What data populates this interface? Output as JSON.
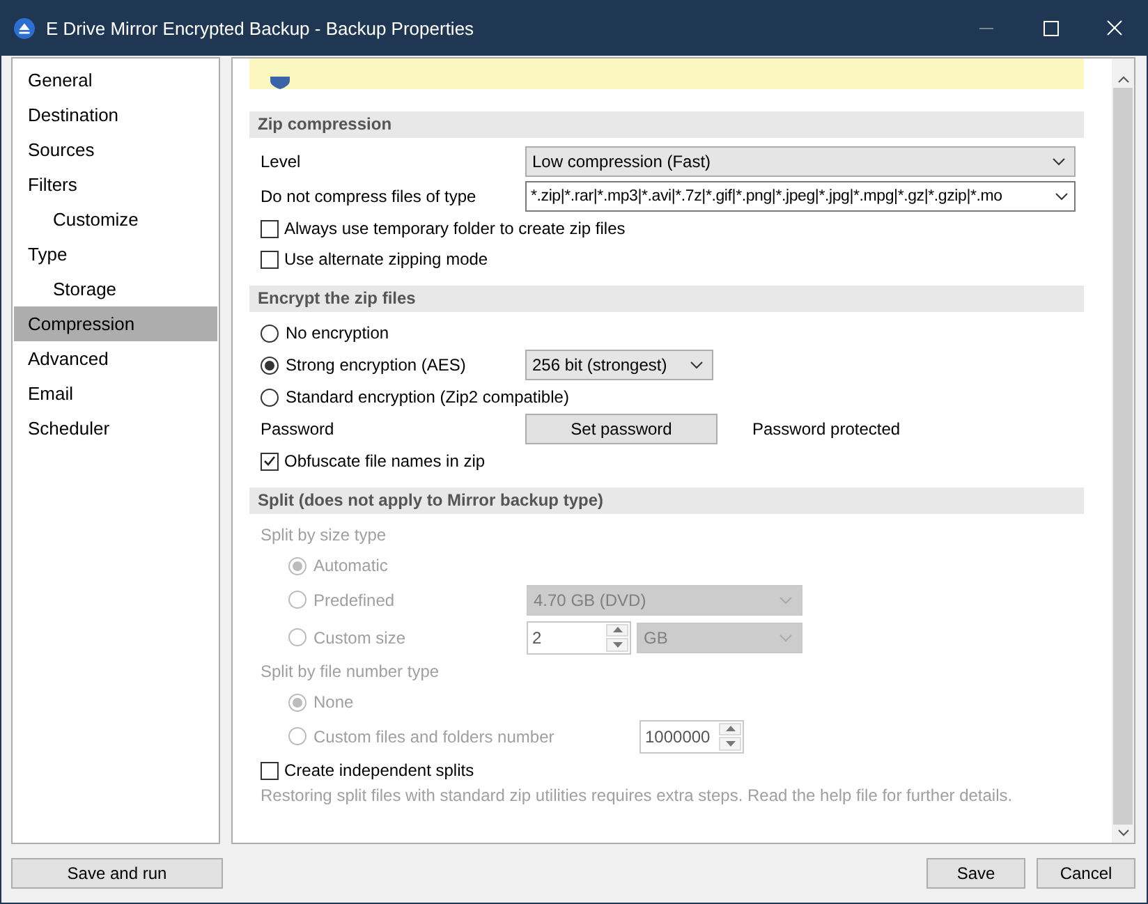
{
  "window": {
    "title": "E Drive Mirror Encrypted Backup - Backup Properties"
  },
  "sidebar": {
    "items": [
      {
        "label": "General",
        "selected": false
      },
      {
        "label": "Destination",
        "selected": false
      },
      {
        "label": "Sources",
        "selected": false
      },
      {
        "label": "Filters",
        "selected": false,
        "children": [
          {
            "label": "Customize",
            "selected": false
          }
        ]
      },
      {
        "label": "Type",
        "selected": false,
        "children": [
          {
            "label": "Storage",
            "selected": false
          }
        ]
      },
      {
        "label": "Compression",
        "selected": true
      },
      {
        "label": "Advanced",
        "selected": false
      },
      {
        "label": "Email",
        "selected": false
      },
      {
        "label": "Scheduler",
        "selected": false
      }
    ]
  },
  "zip_compression": {
    "title": "Zip compression",
    "level": {
      "label": "Level",
      "value": "Low compression (Fast)"
    },
    "exclude": {
      "label": "Do not compress files of type",
      "value": "*.zip|*.rar|*.mp3|*.avi|*.7z|*.gif|*.png|*.jpeg|*.jpg|*.mpg|*.gz|*.gzip|*.mo"
    },
    "options": [
      {
        "label": "Always use temporary folder to create zip files",
        "checked": false
      },
      {
        "label": "Use alternate zipping mode",
        "checked": false
      }
    ]
  },
  "encryption": {
    "title": "Encrypt the zip files",
    "options": [
      {
        "label": "No encryption",
        "selected": false
      },
      {
        "label": "Strong encryption (AES)",
        "selected": true,
        "dropdown": "256 bit (strongest)"
      },
      {
        "label": "Standard encryption (Zip2 compatible)",
        "selected": false
      }
    ],
    "password": {
      "label": "Password",
      "button": "Set password",
      "status": "Password protected"
    },
    "obfuscate": {
      "label": "Obfuscate file names in zip",
      "checked": true
    }
  },
  "split": {
    "title": "Split (does not apply to Mirror backup type)",
    "groups": [
      {
        "label": "Split by size type",
        "disabled": true,
        "options": [
          {
            "kind": "plain",
            "label": "Automatic",
            "selected": true
          },
          {
            "kind": "dropdown",
            "label": "Predefined",
            "selected": false,
            "value": "4.70 GB (DVD)"
          },
          {
            "kind": "spin",
            "label": "Custom size",
            "selected": false,
            "value": "2",
            "unit": "GB"
          }
        ]
      },
      {
        "label": "Split by file number type",
        "disabled": true,
        "options": [
          {
            "kind": "plain",
            "label": "None",
            "selected": true
          },
          {
            "kind": "spin",
            "label": "Custom files and folders number",
            "selected": false,
            "value": "1000000"
          }
        ]
      }
    ],
    "independent": {
      "label": "Create independent splits",
      "checked": false
    },
    "note": "Restoring split files with standard zip utilities requires extra steps. Read the help file for further details."
  },
  "buttons": {
    "left": [
      "Save and run"
    ],
    "right": [
      "Save",
      "Cancel"
    ]
  }
}
